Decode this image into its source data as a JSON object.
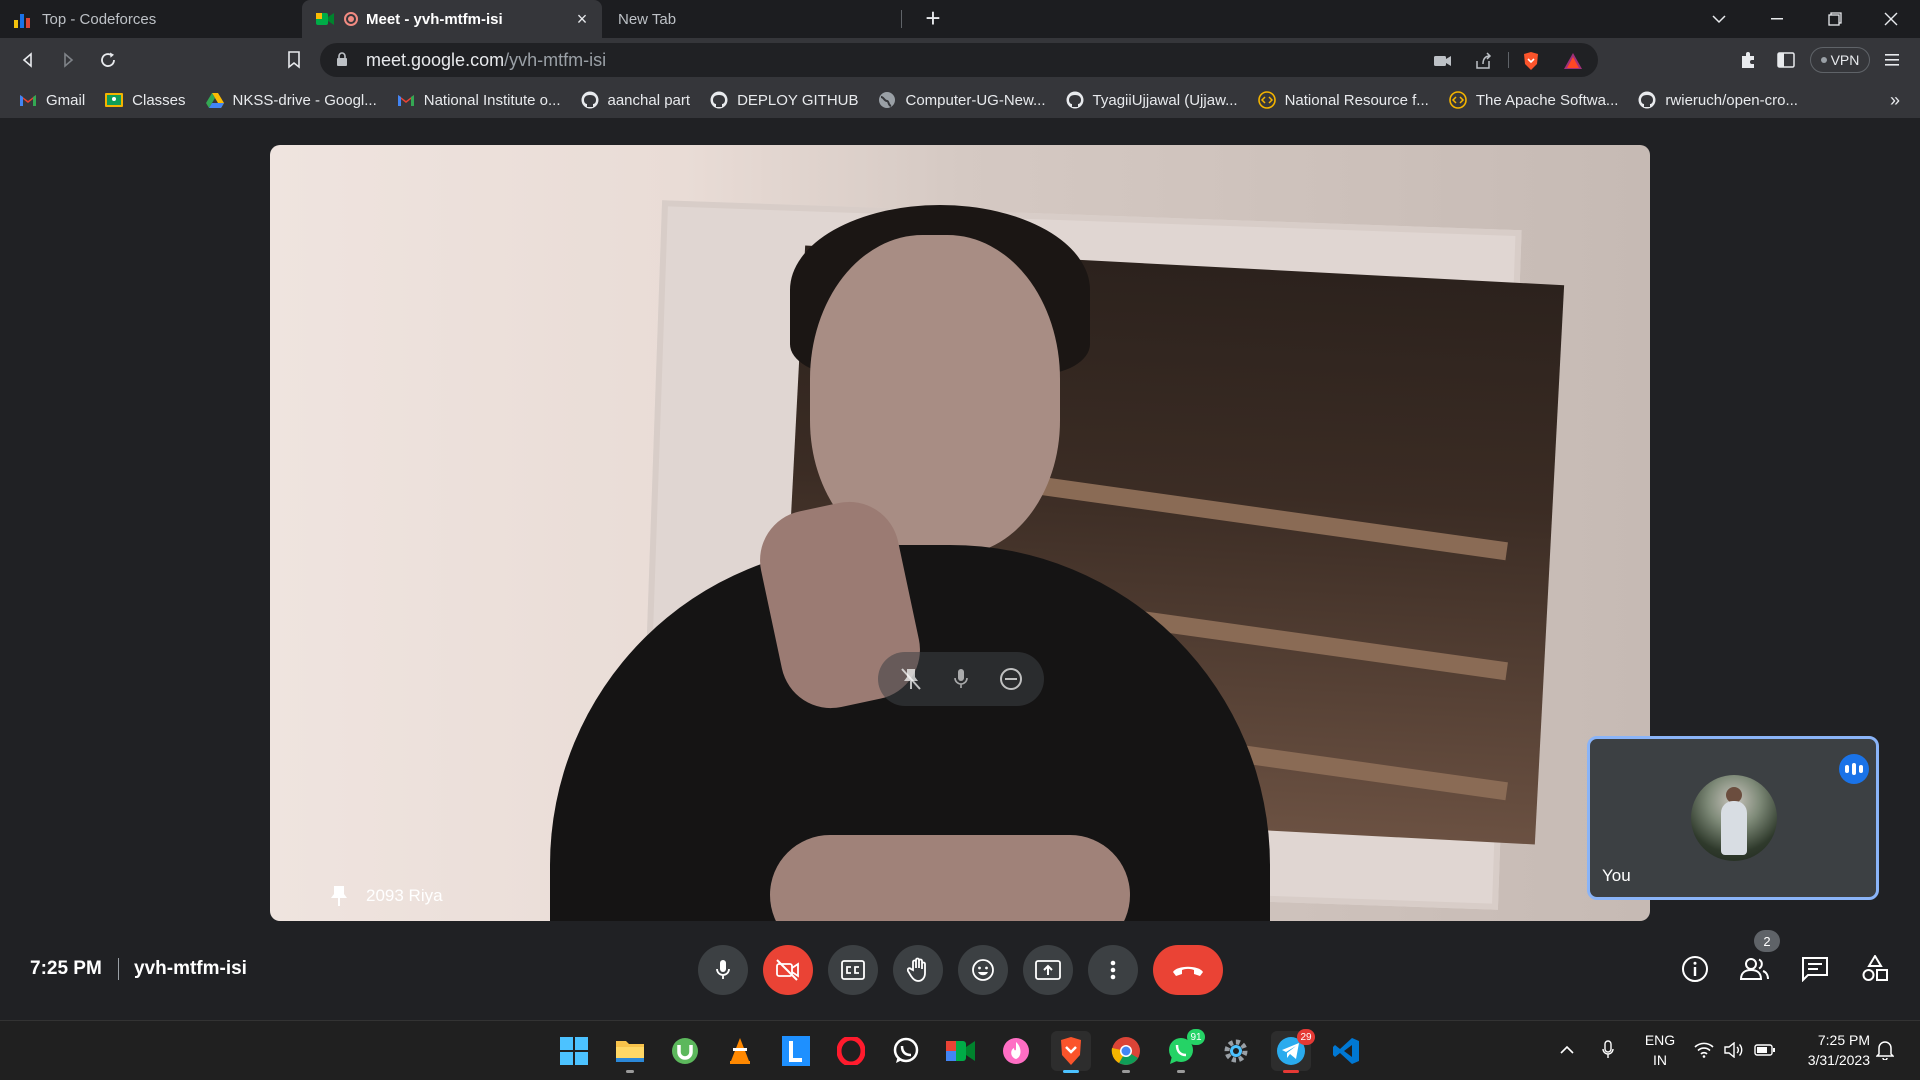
{
  "browser": {
    "tabs": [
      {
        "title": "Top - Codeforces",
        "active": false
      },
      {
        "title": "Meet - yvh-mtfm-isi",
        "active": true
      },
      {
        "title": "New Tab",
        "active": false
      }
    ],
    "address": {
      "host": "meet.google.com",
      "path": "/yvh-mtfm-isi"
    },
    "vpn_label": "VPN",
    "bookmarks": [
      {
        "label": "Gmail",
        "icon": "gmail-icon"
      },
      {
        "label": "Classes",
        "icon": "classroom-icon"
      },
      {
        "label": "NKSS-drive - Googl...",
        "icon": "drive-icon"
      },
      {
        "label": "National Institute o...",
        "icon": "gmail-icon"
      },
      {
        "label": "aanchal part",
        "icon": "github-icon"
      },
      {
        "label": "DEPLOY GITHUB",
        "icon": "github-icon"
      },
      {
        "label": "Computer-UG-New...",
        "icon": "globe-icon"
      },
      {
        "label": "TyagiiUjjawal (Ujjaw...",
        "icon": "github-icon"
      },
      {
        "label": "National Resource f...",
        "icon": "code-icon"
      },
      {
        "label": "The Apache Softwa...",
        "icon": "code-icon"
      },
      {
        "label": "rwieruch/open-cro...",
        "icon": "github-icon"
      }
    ]
  },
  "meet": {
    "main_participant": "2093 Riya",
    "self_label": "You",
    "time": "7:25 PM",
    "meeting_code": "yvh-mtfm-isi",
    "people_count": "2"
  },
  "taskbar": {
    "language": {
      "line1": "ENG",
      "line2": "IN"
    },
    "clock": {
      "time": "7:25 PM",
      "date": "3/31/2023"
    },
    "badges": {
      "whatsapp": "91",
      "telegram": "29"
    }
  },
  "colors": {
    "end_call": "#ea4335",
    "self_tile_border": "#8ab4f8",
    "speaking": "#1a73e8"
  }
}
